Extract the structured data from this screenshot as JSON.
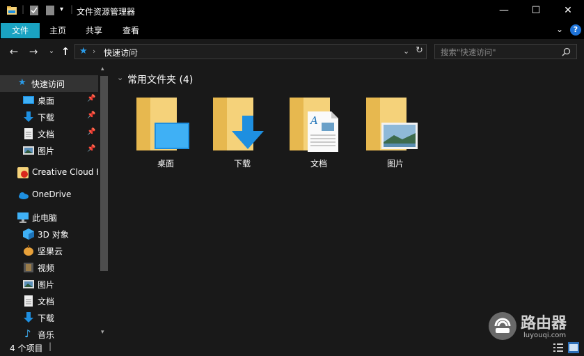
{
  "window": {
    "title": "文件资源管理器",
    "minimize": "—",
    "maximize": "☐",
    "close": "✕"
  },
  "ribbon": {
    "tabs": [
      {
        "label": "文件",
        "active": true
      },
      {
        "label": "主页"
      },
      {
        "label": "共享"
      },
      {
        "label": "查看"
      }
    ],
    "help": "?"
  },
  "address": {
    "path": "快速访问",
    "search_placeholder": "搜索\"快速访问\""
  },
  "nav_pane": {
    "items": [
      {
        "label": "快速访问",
        "icon": "star-icon",
        "selected": true
      },
      {
        "label": "桌面",
        "icon": "desktop-icon",
        "pinned": true
      },
      {
        "label": "下载",
        "icon": "download-icon",
        "pinned": true
      },
      {
        "label": "文档",
        "icon": "document-icon",
        "pinned": true
      },
      {
        "label": "图片",
        "icon": "pictures-icon",
        "pinned": true
      },
      {
        "label": "Creative Cloud F",
        "icon": "creative-cloud-icon"
      },
      {
        "label": "OneDrive",
        "icon": "onedrive-icon"
      },
      {
        "label": "此电脑",
        "icon": "this-pc-icon"
      },
      {
        "label": "3D 对象",
        "icon": "3d-objects-icon"
      },
      {
        "label": "坚果云",
        "icon": "nutstore-icon"
      },
      {
        "label": "视频",
        "icon": "videos-icon"
      },
      {
        "label": "图片",
        "icon": "pictures-icon"
      },
      {
        "label": "文档",
        "icon": "document-icon"
      },
      {
        "label": "下载",
        "icon": "download-icon"
      },
      {
        "label": "音乐",
        "icon": "music-icon"
      }
    ]
  },
  "content": {
    "group_header": "常用文件夹 (4)",
    "folders": [
      {
        "label": "桌面",
        "overlay": "desktop"
      },
      {
        "label": "下载",
        "overlay": "download"
      },
      {
        "label": "文档",
        "overlay": "document"
      },
      {
        "label": "图片",
        "overlay": "pictures"
      }
    ]
  },
  "status": {
    "count": "4 个项目"
  },
  "watermark": {
    "brand": "路由器",
    "url": "luyouqi.com"
  },
  "colors": {
    "accent": "#1aa3c2",
    "folder": "#f5d27a",
    "folder_dark": "#e7b84f",
    "blue": "#1e8fe0"
  }
}
